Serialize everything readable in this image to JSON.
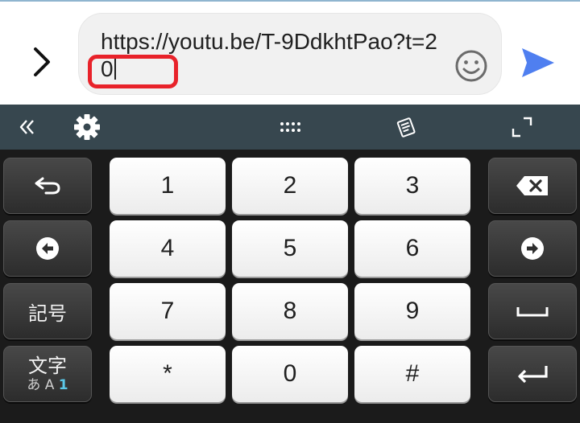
{
  "compose": {
    "message_text": "https://youtu.be/T-9DdkhtPao?t=20"
  },
  "keys": {
    "row1": [
      "1",
      "2",
      "3"
    ],
    "row2": [
      "4",
      "5",
      "6"
    ],
    "row3": [
      "7",
      "8",
      "9"
    ],
    "row4": [
      "*",
      "0",
      "#"
    ],
    "kigou": "記号",
    "moji_top": "文字",
    "moji_bottom_kana": "あ",
    "moji_bottom_alpha": "A",
    "moji_bottom_num": "1"
  },
  "icons": {
    "expand": "chevron-right-icon",
    "emoji": "smiley-icon",
    "send": "send-icon",
    "collapse": "double-chevron-left-icon",
    "settings": "gear-icon",
    "handle": "drag-handle-icon",
    "clipboard": "clipboard-icon",
    "resize": "resize-icon",
    "undo": "undo-icon",
    "cursor_left": "arrow-left-icon",
    "cursor_right": "arrow-right-icon",
    "backspace": "backspace-icon",
    "space": "space-icon",
    "enter": "enter-icon"
  },
  "colors": {
    "send": "#4f7ff0",
    "highlight": "#e8222a",
    "toolbar": "#37474f",
    "moji_num": "#5bc8e8"
  }
}
